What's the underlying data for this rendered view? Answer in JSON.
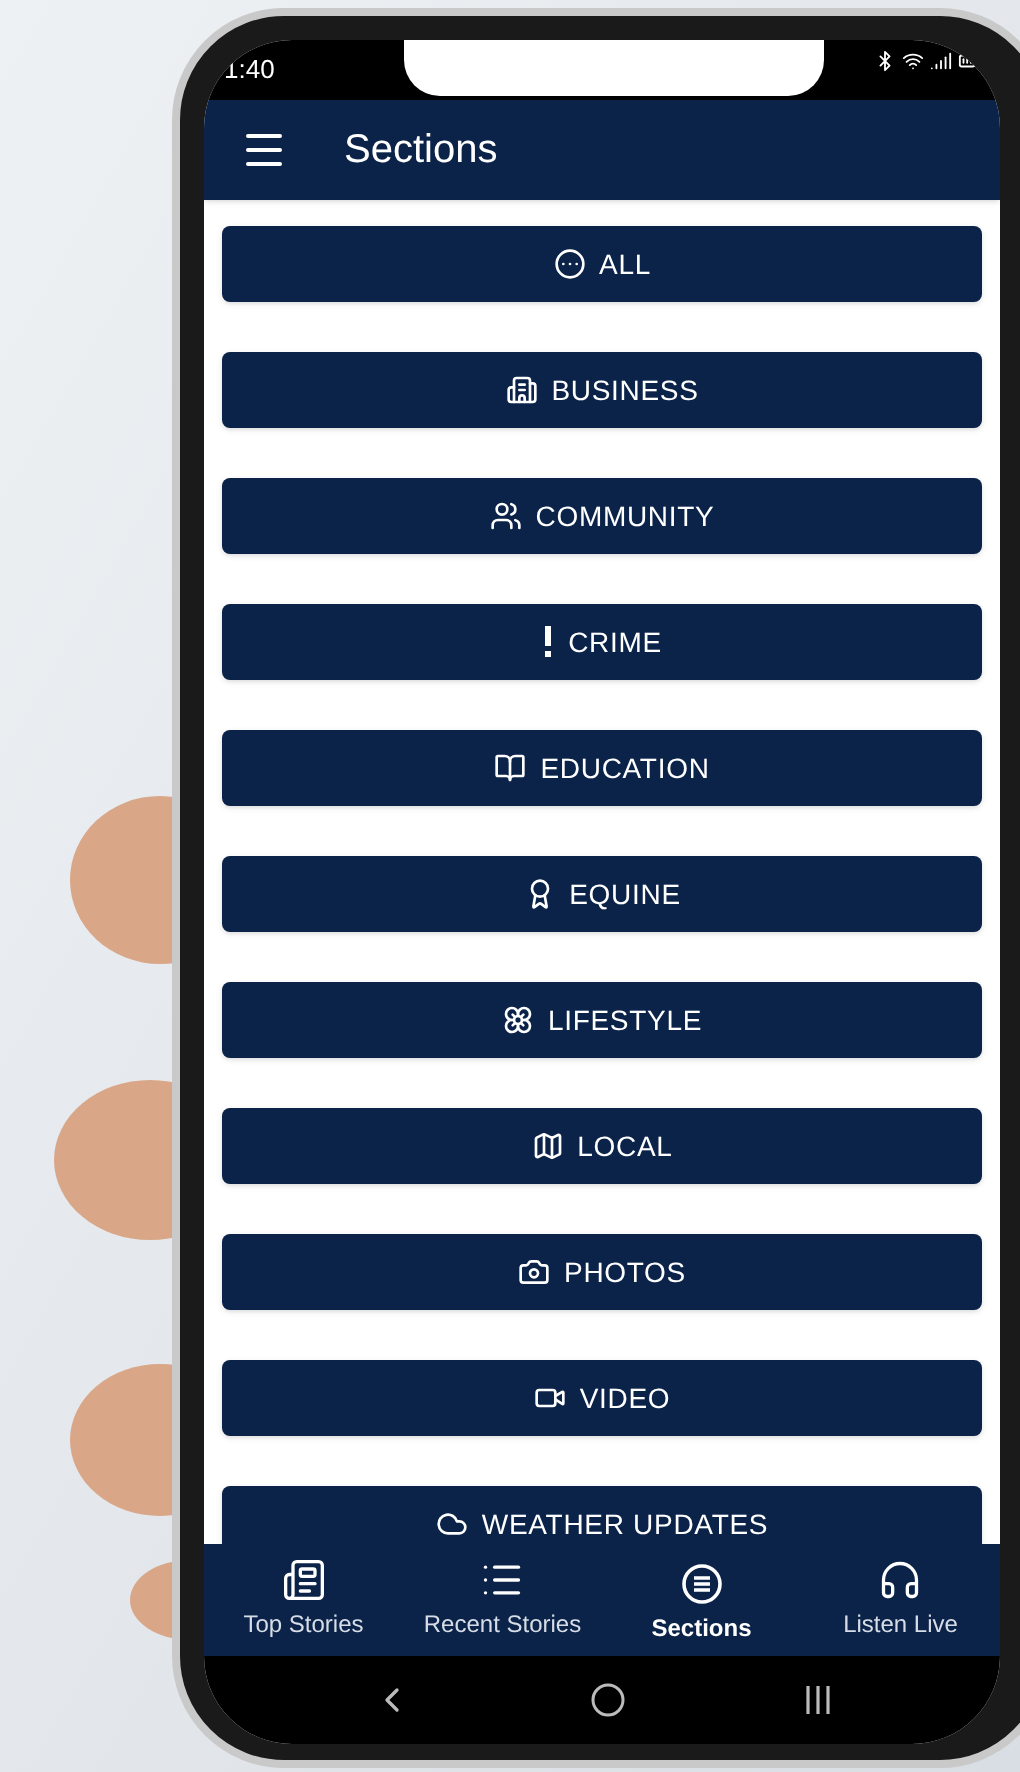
{
  "status_bar": {
    "time": "1:40"
  },
  "app_bar": {
    "title": "Sections"
  },
  "sections": [
    {
      "label": "ALL",
      "kind": "all"
    },
    {
      "label": "BUSINESS",
      "kind": "business"
    },
    {
      "label": "COMMUNITY",
      "kind": "community"
    },
    {
      "label": "CRIME",
      "kind": "crime"
    },
    {
      "label": "EDUCATION",
      "kind": "education"
    },
    {
      "label": "EQUINE",
      "kind": "equine"
    },
    {
      "label": "LIFESTYLE",
      "kind": "lifestyle"
    },
    {
      "label": "LOCAL",
      "kind": "local"
    },
    {
      "label": "PHOTOS",
      "kind": "photos"
    },
    {
      "label": "VIDEO",
      "kind": "video"
    },
    {
      "label": "WEATHER UPDATES",
      "kind": "weather"
    }
  ],
  "bottom_nav": [
    {
      "label": "Top Stories",
      "kind": "top",
      "selected": false
    },
    {
      "label": "Recent Stories",
      "kind": "recent",
      "selected": false
    },
    {
      "label": "Sections",
      "kind": "sections",
      "selected": true
    },
    {
      "label": "Listen Live",
      "kind": "listen",
      "selected": false
    }
  ]
}
